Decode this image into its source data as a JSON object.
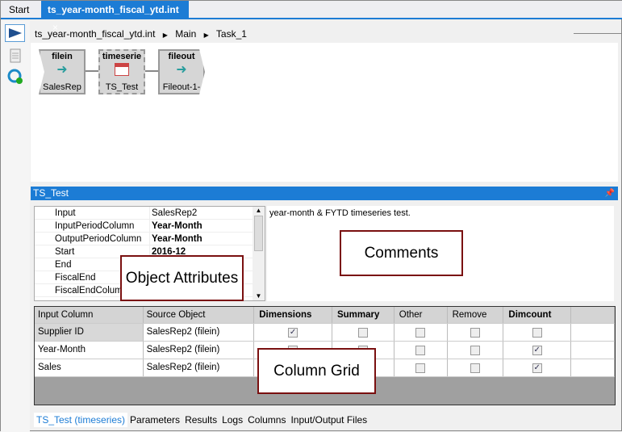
{
  "tabs": [
    {
      "label": "Start"
    },
    {
      "label": "ts_year-month_fiscal_ytd.int",
      "close": "×"
    }
  ],
  "breadcrumb": [
    "ts_year-month_fiscal_ytd.int",
    "Main",
    "Task_1"
  ],
  "nodes": [
    {
      "type": "filein",
      "name": "SalesRep"
    },
    {
      "type": "timeserie",
      "name": "TS_Test"
    },
    {
      "type": "fileout",
      "name": "Fileout-1-"
    }
  ],
  "panel": {
    "title": "TS_Test"
  },
  "attributes": [
    {
      "key": "Input",
      "value": "SalesRep2",
      "bold": false
    },
    {
      "key": "InputPeriodColumn",
      "value": "Year-Month",
      "bold": true
    },
    {
      "key": "OutputPeriodColumn",
      "value": "Year-Month",
      "bold": true
    },
    {
      "key": "Start",
      "value": "2016-12",
      "bold": true
    },
    {
      "key": "End",
      "value": ""
    },
    {
      "key": "FiscalEnd",
      "value": ""
    },
    {
      "key": "FiscalEndColumn",
      "value": ""
    }
  ],
  "comments": "year-month & FYTD timeseries test.",
  "grid": {
    "headers": [
      "Input Column",
      "Source Object",
      "Dimensions",
      "Summary",
      "Other",
      "Remove",
      "Dimcount"
    ],
    "rows": [
      {
        "col": "Supplier ID",
        "src": "SalesRep2 (filein)",
        "checks": [
          true,
          false,
          false,
          false,
          false
        ]
      },
      {
        "col": "Year-Month",
        "src": "SalesRep2 (filein)",
        "checks": [
          false,
          false,
          false,
          false,
          true
        ]
      },
      {
        "col": "Sales",
        "src": "SalesRep2 (filein)",
        "checks": [
          false,
          false,
          false,
          false,
          true
        ]
      }
    ]
  },
  "bottom_tabs": [
    "TS_Test (timeseries)",
    "Parameters",
    "Results",
    "Logs",
    "Columns",
    "Input/Output Files"
  ],
  "callouts": {
    "attributes": "Object Attributes",
    "comments": "Comments",
    "grid": "Column Grid"
  },
  "colors": {
    "accent": "#1c7cd5",
    "callout_border": "#7a1010"
  }
}
